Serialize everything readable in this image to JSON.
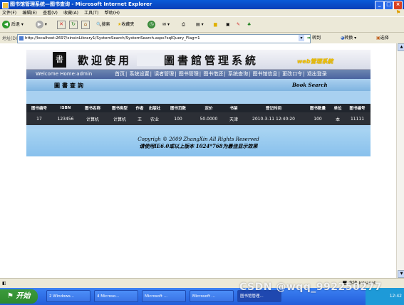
{
  "window": {
    "title": "图书馆管理系统—图书查询 - Microsoft Internet Explorer",
    "buttons": {
      "minimize": "_",
      "maximize": "□",
      "close": "×"
    }
  },
  "menubar": [
    "文件(F)",
    "编辑(E)",
    "查看(V)",
    "收藏(A)",
    "工具(T)",
    "帮助(H)"
  ],
  "toolbar": {
    "back": "后退",
    "search": "搜索",
    "favorites": "收藏夹"
  },
  "addressbar": {
    "label": "地址(D)",
    "url": "http://localhost:2697/xinxinLibrary1/SystemSearch/SystemSearch.aspx?sqlQuery_Flag=1",
    "go": "转到",
    "convert": "转换",
    "select": "选择"
  },
  "banner": {
    "logo_char": "書",
    "welcome": "歡迎使用",
    "system": "圖書館管理系統",
    "web_title": "web管理系統"
  },
  "nav": {
    "welcome": "Welcome Home:admin",
    "links": [
      "首页",
      "系统设置",
      "读者管理",
      "图书管理",
      "图书借还",
      "系统查询",
      "图书馆信息",
      "更改口令",
      "退出登录"
    ],
    "separator": "|"
  },
  "query_header": {
    "left": "圖書查詢",
    "right": "Book Search"
  },
  "table": {
    "columns": [
      "图书编号",
      "ISBN",
      "图书名称",
      "图书类型",
      "作者",
      "出版社",
      "图书页数",
      "定价",
      "书架",
      "登记时间",
      "图书数量",
      "单位",
      "图书编号"
    ],
    "rows": [
      [
        "17",
        "123456",
        "计算机",
        "计算机",
        "王",
        "农业",
        "100",
        "50.0000",
        "天津",
        "2010-3-11 12:40:20",
        "100",
        "本",
        "11111"
      ]
    ]
  },
  "footer": {
    "copyright": "Copyrigh © 2009 ZhangXin   All Rights Reserved",
    "note": "请使用IE6.0或以上版本  1024*768为最佳显示效果"
  },
  "statusbar": {
    "zone": "本地 Intranet"
  },
  "taskbar": {
    "start": "开始",
    "tasks": [
      "2 Windows...",
      "4 Microso...",
      "Microsoft ...",
      "Microsoft ...",
      "图书馆管理..."
    ],
    "time": "12:42"
  },
  "watermark": "CSDN @wqq_992250277"
}
